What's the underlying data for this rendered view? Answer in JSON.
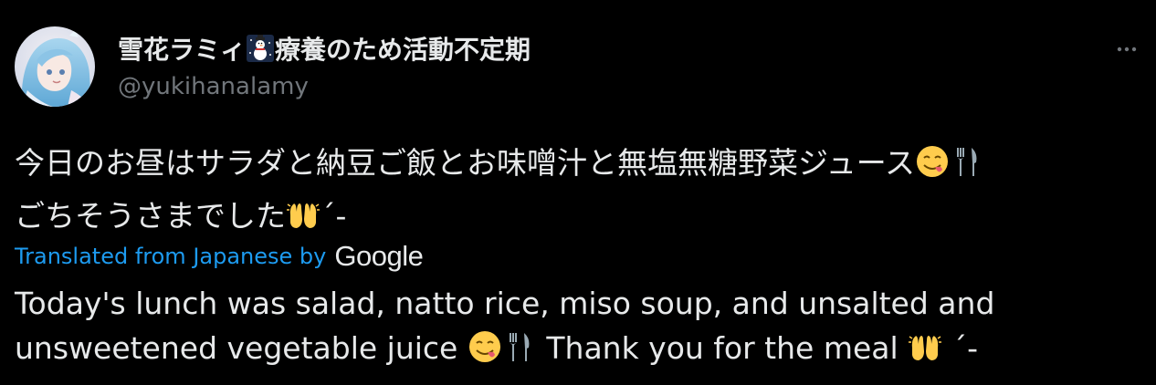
{
  "tweet": {
    "display_name_part1": "雪花ラミィ",
    "display_name_emoji": "snowman-icon",
    "display_name_part2": "療養のため活動不定期",
    "handle": "@yukihanalamy",
    "more_icon": "more-dots-icon",
    "original_text_line1": "今日のお昼はサラダと納豆ご飯とお味噌汁と無塩無糖野菜ジュース",
    "original_text_line2": "ごちそうさまでした",
    "original_text_line2_tail": "´-",
    "translated_label": "Translated from Japanese by",
    "google_label": "Google",
    "translation_line1": "Today's lunch was salad, natto rice, miso soup, and unsalted and",
    "translation_line2_a": "unsweetened vegetable juice",
    "translation_line2_b": "Thank you for the meal",
    "translation_line2_tail": "´-",
    "emojis": [
      "yum-face-icon",
      "fork-knife-icon",
      "raising-hands-icon"
    ],
    "colors": {
      "background": "#000000",
      "text": "#e7e9ea",
      "secondary": "#71767b",
      "link": "#1d9bf0"
    }
  }
}
